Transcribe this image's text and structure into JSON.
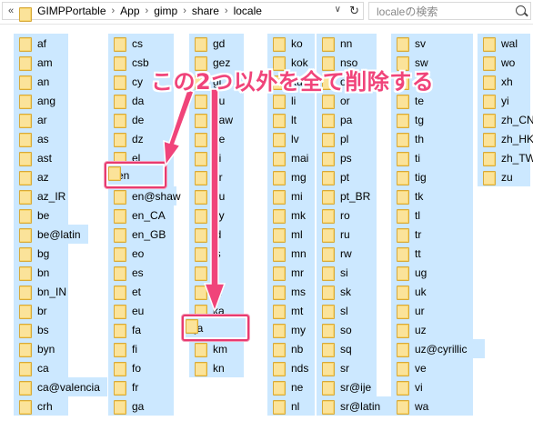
{
  "address_bar": {
    "breadcrumb": [
      "GIMPPortable",
      "App",
      "gimp",
      "share",
      "locale"
    ],
    "overflow_glyph": "«"
  },
  "search": {
    "placeholder": "localeの検索"
  },
  "annotation": {
    "text": "この2つ以外を全て削除する",
    "color": "#f0447a"
  },
  "highlighted": [
    "en",
    "ja"
  ],
  "columns": [
    [
      "af",
      "am",
      "an",
      "ang",
      "ar",
      "as",
      "ast",
      "az",
      "az_IR",
      "be",
      "be@latin",
      "bg",
      "bn",
      "bn_IN",
      "br",
      "bs",
      "byn",
      "ca",
      "ca@valencia",
      "crh"
    ],
    [
      "cs",
      "csb",
      "cy",
      "da",
      "de",
      "dz",
      "el",
      "en",
      "en@shaw",
      "en_CA",
      "en_GB",
      "eo",
      "es",
      "et",
      "eu",
      "fa",
      "fi",
      "fo",
      "fr",
      "ga"
    ],
    [
      "gd",
      "gez",
      "gl",
      "gu",
      "haw",
      "he",
      "hi",
      "hr",
      "hu",
      "hy",
      "id",
      "is",
      "it",
      "ja",
      "ka",
      "kk",
      "km",
      "kn"
    ],
    [
      "ko",
      "kok",
      "ku",
      "li",
      "lt",
      "lv",
      "mai",
      "mg",
      "mi",
      "mk",
      "ml",
      "mn",
      "mr",
      "ms",
      "mt",
      "my",
      "nb",
      "nds",
      "ne",
      "nl"
    ],
    [
      "nn",
      "nso",
      "oc",
      "or",
      "pa",
      "pl",
      "ps",
      "pt",
      "pt_BR",
      "ro",
      "ru",
      "rw",
      "si",
      "sk",
      "sl",
      "so",
      "sq",
      "sr",
      "sr@ije",
      "sr@latin"
    ],
    [
      "sv",
      "sw",
      "ta",
      "te",
      "tg",
      "th",
      "ti",
      "tig",
      "tk",
      "tl",
      "tr",
      "tt",
      "ug",
      "uk",
      "ur",
      "uz",
      "uz@cyrillic",
      "ve",
      "vi",
      "wa"
    ],
    [
      "wal",
      "wo",
      "xh",
      "yi",
      "zh_CN",
      "zh_HK",
      "zh_TW",
      "zu"
    ]
  ],
  "colors": {
    "selection": "#cce8ff",
    "folder": "#f9d66d",
    "highlight_border": "#e83a6f"
  }
}
